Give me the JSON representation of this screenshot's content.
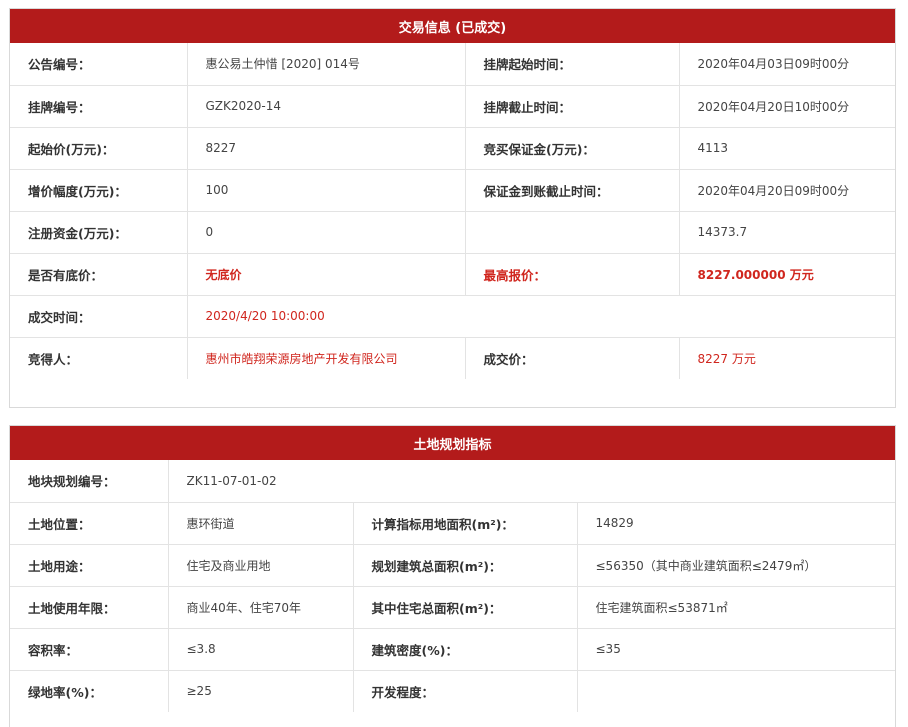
{
  "trade": {
    "header": "交易信息 (已成交)",
    "rows": [
      [
        "公告编号：",
        "惠公易土仲惜 [2020] 014号",
        "挂牌起始时间：",
        "2020年04月03日09时00分"
      ],
      [
        "挂牌编号：",
        "GZK2020-14",
        "挂牌截止时间：",
        "2020年04月20日10时00分"
      ],
      [
        "起始价(万元)：",
        "8227",
        "竞买保证金(万元)：",
        "4113"
      ],
      [
        "增价幅度(万元)：",
        "100",
        "保证金到账截止时间：",
        "2020年04月20日09时00分"
      ],
      [
        "注册资金(万元)：",
        "0",
        "",
        "14373.7"
      ],
      [
        "是否有底价：",
        "无底价",
        "最高报价：",
        "8227.000000 万元"
      ],
      [
        "成交时间：",
        "2020/4/20 10:00:00"
      ],
      [
        "竞得人：",
        "惠州市皓翔荣源房地产开发有限公司",
        "成交价：",
        "8227 万元"
      ]
    ]
  },
  "planning": {
    "header": "土地规划指标",
    "rows": [
      [
        "地块规划编号：",
        "ZK11-07-01-02"
      ],
      [
        "土地位置：",
        "惠环街道",
        "计算指标用地面积(m²)：",
        "14829"
      ],
      [
        "土地用途：",
        "住宅及商业用地",
        "规划建筑总面积(m²)：",
        "≤56350（其中商业建筑面积≤2479㎡）"
      ],
      [
        "土地使用年限：",
        "商业40年、住宅70年",
        "其中住宅总面积(m²)：",
        "住宅建筑面积≤53871㎡"
      ],
      [
        "容积率：",
        "≤3.8",
        "建筑密度(%)：",
        "≤35"
      ],
      [
        "绿地率(%)：",
        "≥25",
        "开发程度：",
        ""
      ]
    ]
  },
  "colors": {
    "header_bg": "#b31b1b",
    "highlight_text": "#d0261e",
    "border": "#e3e3e3"
  }
}
